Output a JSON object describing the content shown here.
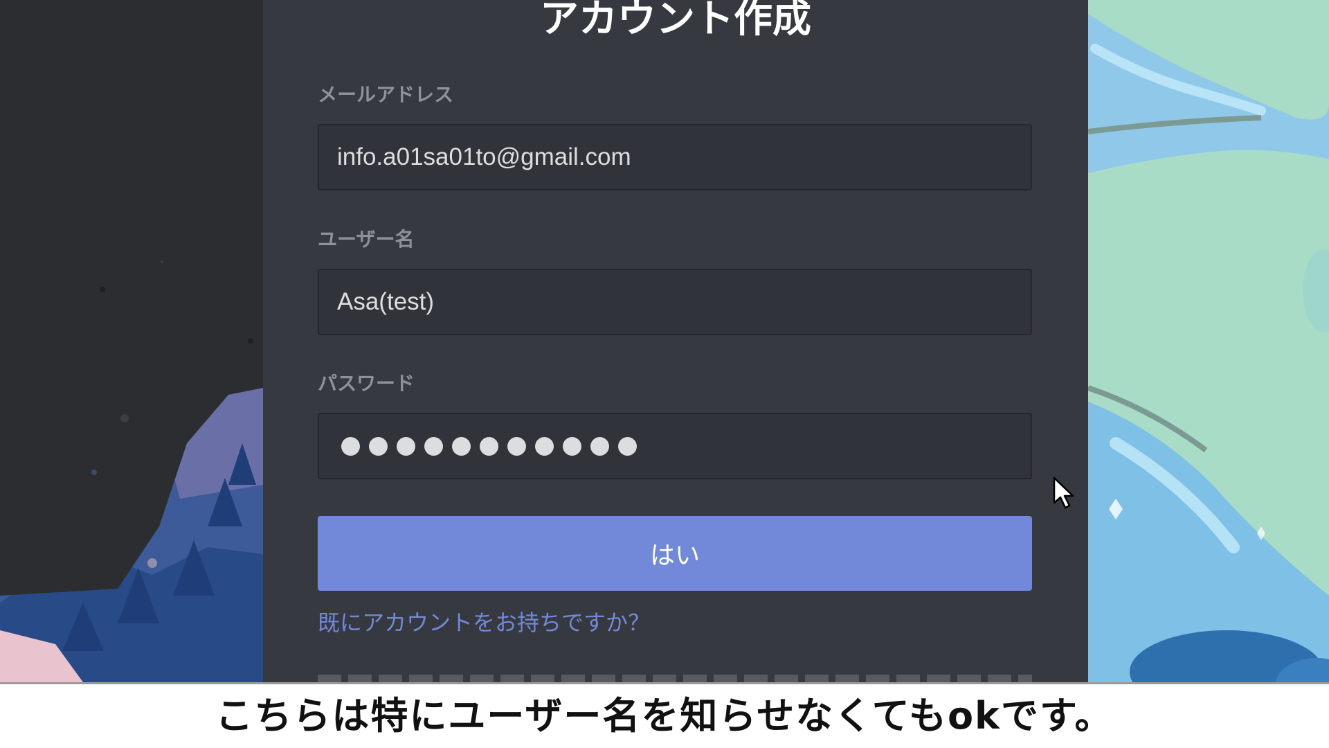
{
  "modal": {
    "title": "アカウント作成",
    "email": {
      "label": "メールアドレス",
      "value": "info.a01sa01to@gmail.com"
    },
    "username": {
      "label": "ユーザー名",
      "value": "Asa(test)"
    },
    "password": {
      "label": "パスワード",
      "dot_count": 11
    },
    "submit_label": "はい",
    "login_link": "既にアカウントをお持ちですか？"
  },
  "subtitle": "こちらは特にユーザー名を知らせなくてもokです。",
  "icons": {
    "cursor": "mouse-pointer-icon"
  },
  "colors": {
    "modal_bg": "#36393f",
    "input_bg": "#303339",
    "accent": "#7289da",
    "label": "#8e9297",
    "right_art_bg": "#a8dcc6"
  }
}
